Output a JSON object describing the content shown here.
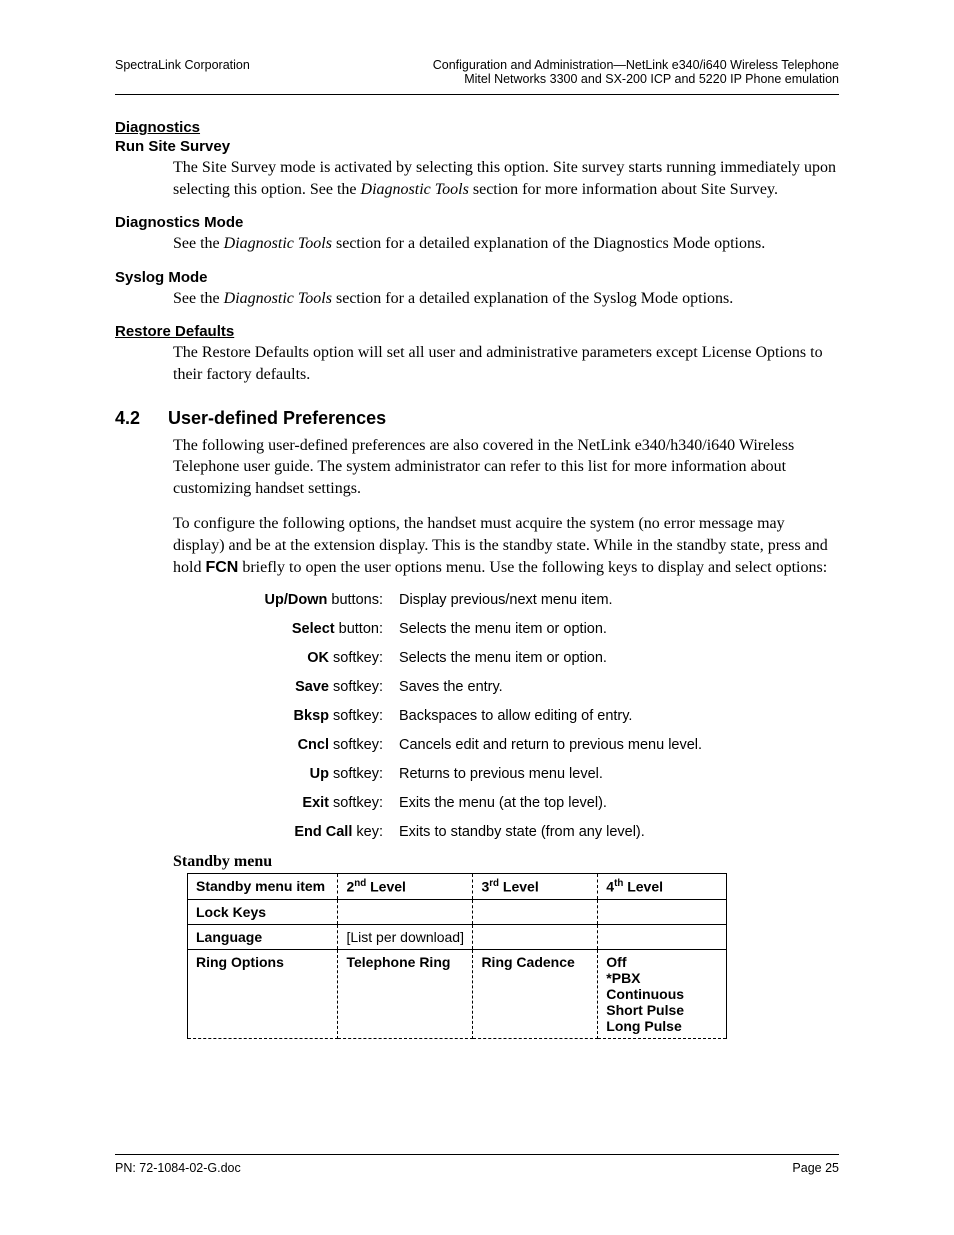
{
  "header": {
    "left": "SpectraLink Corporation",
    "right1": "Configuration and Administration—NetLink e340/i640 Wireless Telephone",
    "right2": "Mitel Networks 3300 and SX-200 ICP and 5220 IP Phone emulation"
  },
  "diagnostics": {
    "title": "Diagnostics",
    "run_site_survey": "Run Site Survey",
    "run_site_survey_body_1": "The Site Survey mode is activated by selecting this option. Site survey starts running immediately upon selecting this option. See the ",
    "run_site_survey_body_italic": "Diagnostic Tools",
    "run_site_survey_body_2": " section for more information about Site Survey.",
    "diag_mode": "Diagnostics Mode",
    "diag_mode_body_1": "See the ",
    "diag_mode_body_italic": "Diagnostic Tools",
    "diag_mode_body_2": " section for a detailed explanation of the Diagnostics Mode options.",
    "syslog": "Syslog Mode",
    "syslog_body_1": "See the ",
    "syslog_body_italic": "Diagnostic Tools",
    "syslog_body_2": " section for a detailed explanation of the Syslog Mode options."
  },
  "restore": {
    "title": "Restore Defaults",
    "body": "The Restore Defaults option will set all user and administrative parameters except License Options to their factory defaults."
  },
  "chapter": {
    "num": "4.2",
    "title": "User-defined Preferences",
    "p1": "The following user-defined preferences are also covered in the NetLink e340/h340/i640 Wireless Telephone user guide. The system administrator can refer to this list for more information about customizing handset settings.",
    "p2_a": "To configure the following options, the handset must acquire the system (no error message may display) and be at the extension display. This is the standby state. While in the standby state, press and hold ",
    "p2_fcn": "FCN",
    "p2_b": " briefly to open the user options menu. Use the following keys to display and select options:"
  },
  "keys": [
    {
      "kb": "Up/Down",
      "suffix": " buttons:",
      "desc": "Display previous/next menu item."
    },
    {
      "kb": "Select",
      "suffix": " button:",
      "desc": "Selects the menu item or option."
    },
    {
      "kb": "OK",
      "suffix": " softkey:",
      "desc": "Selects the menu item or option."
    },
    {
      "kb": "Save",
      "suffix": " softkey:",
      "desc": "Saves the entry."
    },
    {
      "kb": "Bksp",
      "suffix": " softkey:",
      "desc": "Backspaces to allow editing of entry."
    },
    {
      "kb": "Cncl",
      "suffix": " softkey:",
      "desc": "Cancels edit and return to previous menu level."
    },
    {
      "kb": "Up",
      "suffix": " softkey:",
      "desc": "Returns to previous menu level."
    },
    {
      "kb": "Exit",
      "suffix": " softkey:",
      "desc": "Exits the menu (at the top level)."
    },
    {
      "kb": "End Call",
      "suffix": " key:",
      "desc": "Exits to standby state (from any level)."
    }
  ],
  "standby": {
    "title": "Standby menu",
    "headers": {
      "c1": "Standby menu item",
      "c2_pre": "2",
      "c2_sup": "nd",
      "c2_post": " Level",
      "c3_pre": "3",
      "c3_sup": "rd",
      "c3_post": " Level",
      "c4_pre": "4",
      "c4_sup": "th",
      "c4_post": " Level"
    },
    "rows": [
      {
        "c1": "Lock Keys",
        "c2": "",
        "c3": "",
        "c4": ""
      },
      {
        "c1": "Language",
        "c2": "[List per download]",
        "c3": "",
        "c4": ""
      },
      {
        "c1": "Ring Options",
        "c2": "Telephone Ring",
        "c3": "Ring Cadence",
        "c4": "Off\n*PBX\nContinuous\nShort Pulse\nLong Pulse"
      }
    ]
  },
  "footer": {
    "left": "PN: 72-1084-02-G.doc",
    "right": "Page 25"
  }
}
